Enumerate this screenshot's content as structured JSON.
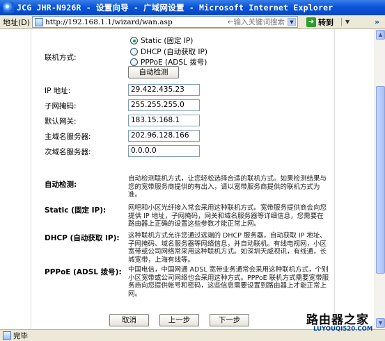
{
  "window": {
    "title": "JCG JHR-N926R - 设置向导 - 广域网设置 - Microsoft Internet Explorer"
  },
  "address_bar": {
    "label": "地址(D)",
    "url": "http://192.168.1.1/wizard/wan.asp",
    "search_hint": "←输入关键词搜索",
    "go_label": "转到"
  },
  "form": {
    "connection_label": "联机方式:",
    "connection_options": [
      {
        "label": "Static (固定 IP)",
        "selected": true
      },
      {
        "label": "DHCP (自动获取 IP)",
        "selected": false
      },
      {
        "label": "PPPoE (ADSL 拨号)",
        "selected": false
      }
    ],
    "auto_detect_button": "自动检测",
    "fields": [
      {
        "label": "IP 地址:",
        "value": "29.422.435.23"
      },
      {
        "label": "子网掩码:",
        "value": "255.255.255.0"
      },
      {
        "label": "默认网关:",
        "value": "183.15.168.1"
      },
      {
        "label": "主域名服务器:",
        "value": "202.96.128.166"
      },
      {
        "label": "次域名服务器:",
        "value": "0.0.0.0"
      }
    ]
  },
  "help": [
    {
      "term": "自动检测:",
      "text": "自动检测联机方式，让您轻松选择合适的联机方式。如果检测结果与您的宽带服务商提供的有出入，请以宽带服务商提供的联机方式为准。"
    },
    {
      "term": "Static (固定 IP):",
      "text": "网吧和小区光纤接入常会采用这种联机方式。宽带服务提供商会向您提供 IP 地址，子网掩码，网关和域名服务器等详细信息，您需要在路由器上正确的设置这些参数才能正常上网。"
    },
    {
      "term": "DHCP (自动获取 IP):",
      "text": "这种联机方式允许您通过远端的 DHCP 服务器，自动获取 IP 地址、子网掩码、域名服务器等网络信息，并自动联机。有线电视网，小区宽带或公司网络常采用这种联机方式。如深圳天威视讯，有线通，长城宽带，上海有线等。"
    },
    {
      "term": "PPPoE (ADSL 拨号):",
      "text": "中国电信，中国网通 ADSL 宽带业务通常会采用这种联机方式，个别小区宽带或公司网络也会采用这种方式。PPPoE 联机方式需要宽带服务商向您提供帐号和密码，这些信息需要设置到路由器上才能正常上网。"
    }
  ],
  "nav": {
    "cancel": "取消",
    "prev": "上一步",
    "next": "下一步"
  },
  "status_bar": {
    "text": "完毕"
  },
  "watermark": {
    "main": "路由器之家",
    "sub": "LUYOUQI520.COM"
  }
}
